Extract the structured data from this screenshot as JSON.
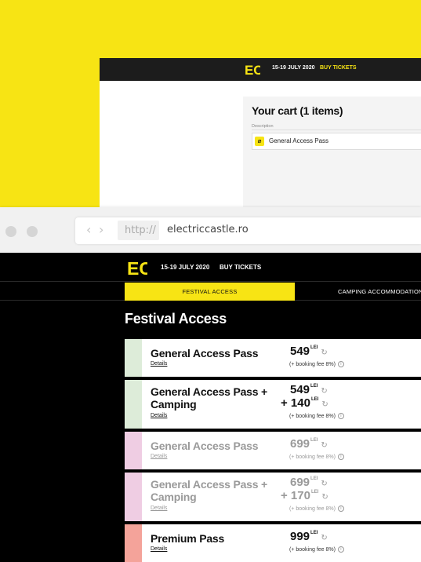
{
  "background_page": {
    "logo": "EC",
    "dates": "15-19 JULY 2020",
    "buy_tickets": "BUY TICKETS",
    "cart_title": "Your cart (1 items)",
    "description_label": "Description",
    "cart_item": "General Access Pass"
  },
  "browser": {
    "back": "‹",
    "forward": "›",
    "protocol": "http://",
    "domain": "electriccastle.ro"
  },
  "site": {
    "logo": "EC",
    "dates": "15-19 JULY 2020",
    "buy_tickets": "BUY TICKETS",
    "tabs": [
      "FESTIVAL ACCESS",
      "CAMPING ACCOMMODATION"
    ],
    "page_title": "Festival Access",
    "currency": "LEI",
    "details_label": "Details",
    "fee_label": "(+ booking fee 8%)",
    "tickets": [
      {
        "name": "General Access Pass",
        "price": "549",
        "extra": null,
        "sold_out": false,
        "stripe": "#ddecd9"
      },
      {
        "name": "General Access Pass + Camping",
        "price": "549",
        "extra": "+ 140",
        "sold_out": false,
        "stripe": "#ddecd9"
      },
      {
        "name": "General Access Pass",
        "price": "699",
        "extra": null,
        "sold_out": true,
        "stripe": "#efcde3"
      },
      {
        "name": "General Access Pass + Camping",
        "price": "699",
        "extra": "+ 170",
        "sold_out": true,
        "stripe": "#efcde3"
      },
      {
        "name": "Premium Pass",
        "price": "999",
        "extra": null,
        "sold_out": false,
        "stripe": "#f4a39a"
      }
    ]
  },
  "colors": {
    "brand_yellow": "#f7e414",
    "dark": "#000000"
  }
}
